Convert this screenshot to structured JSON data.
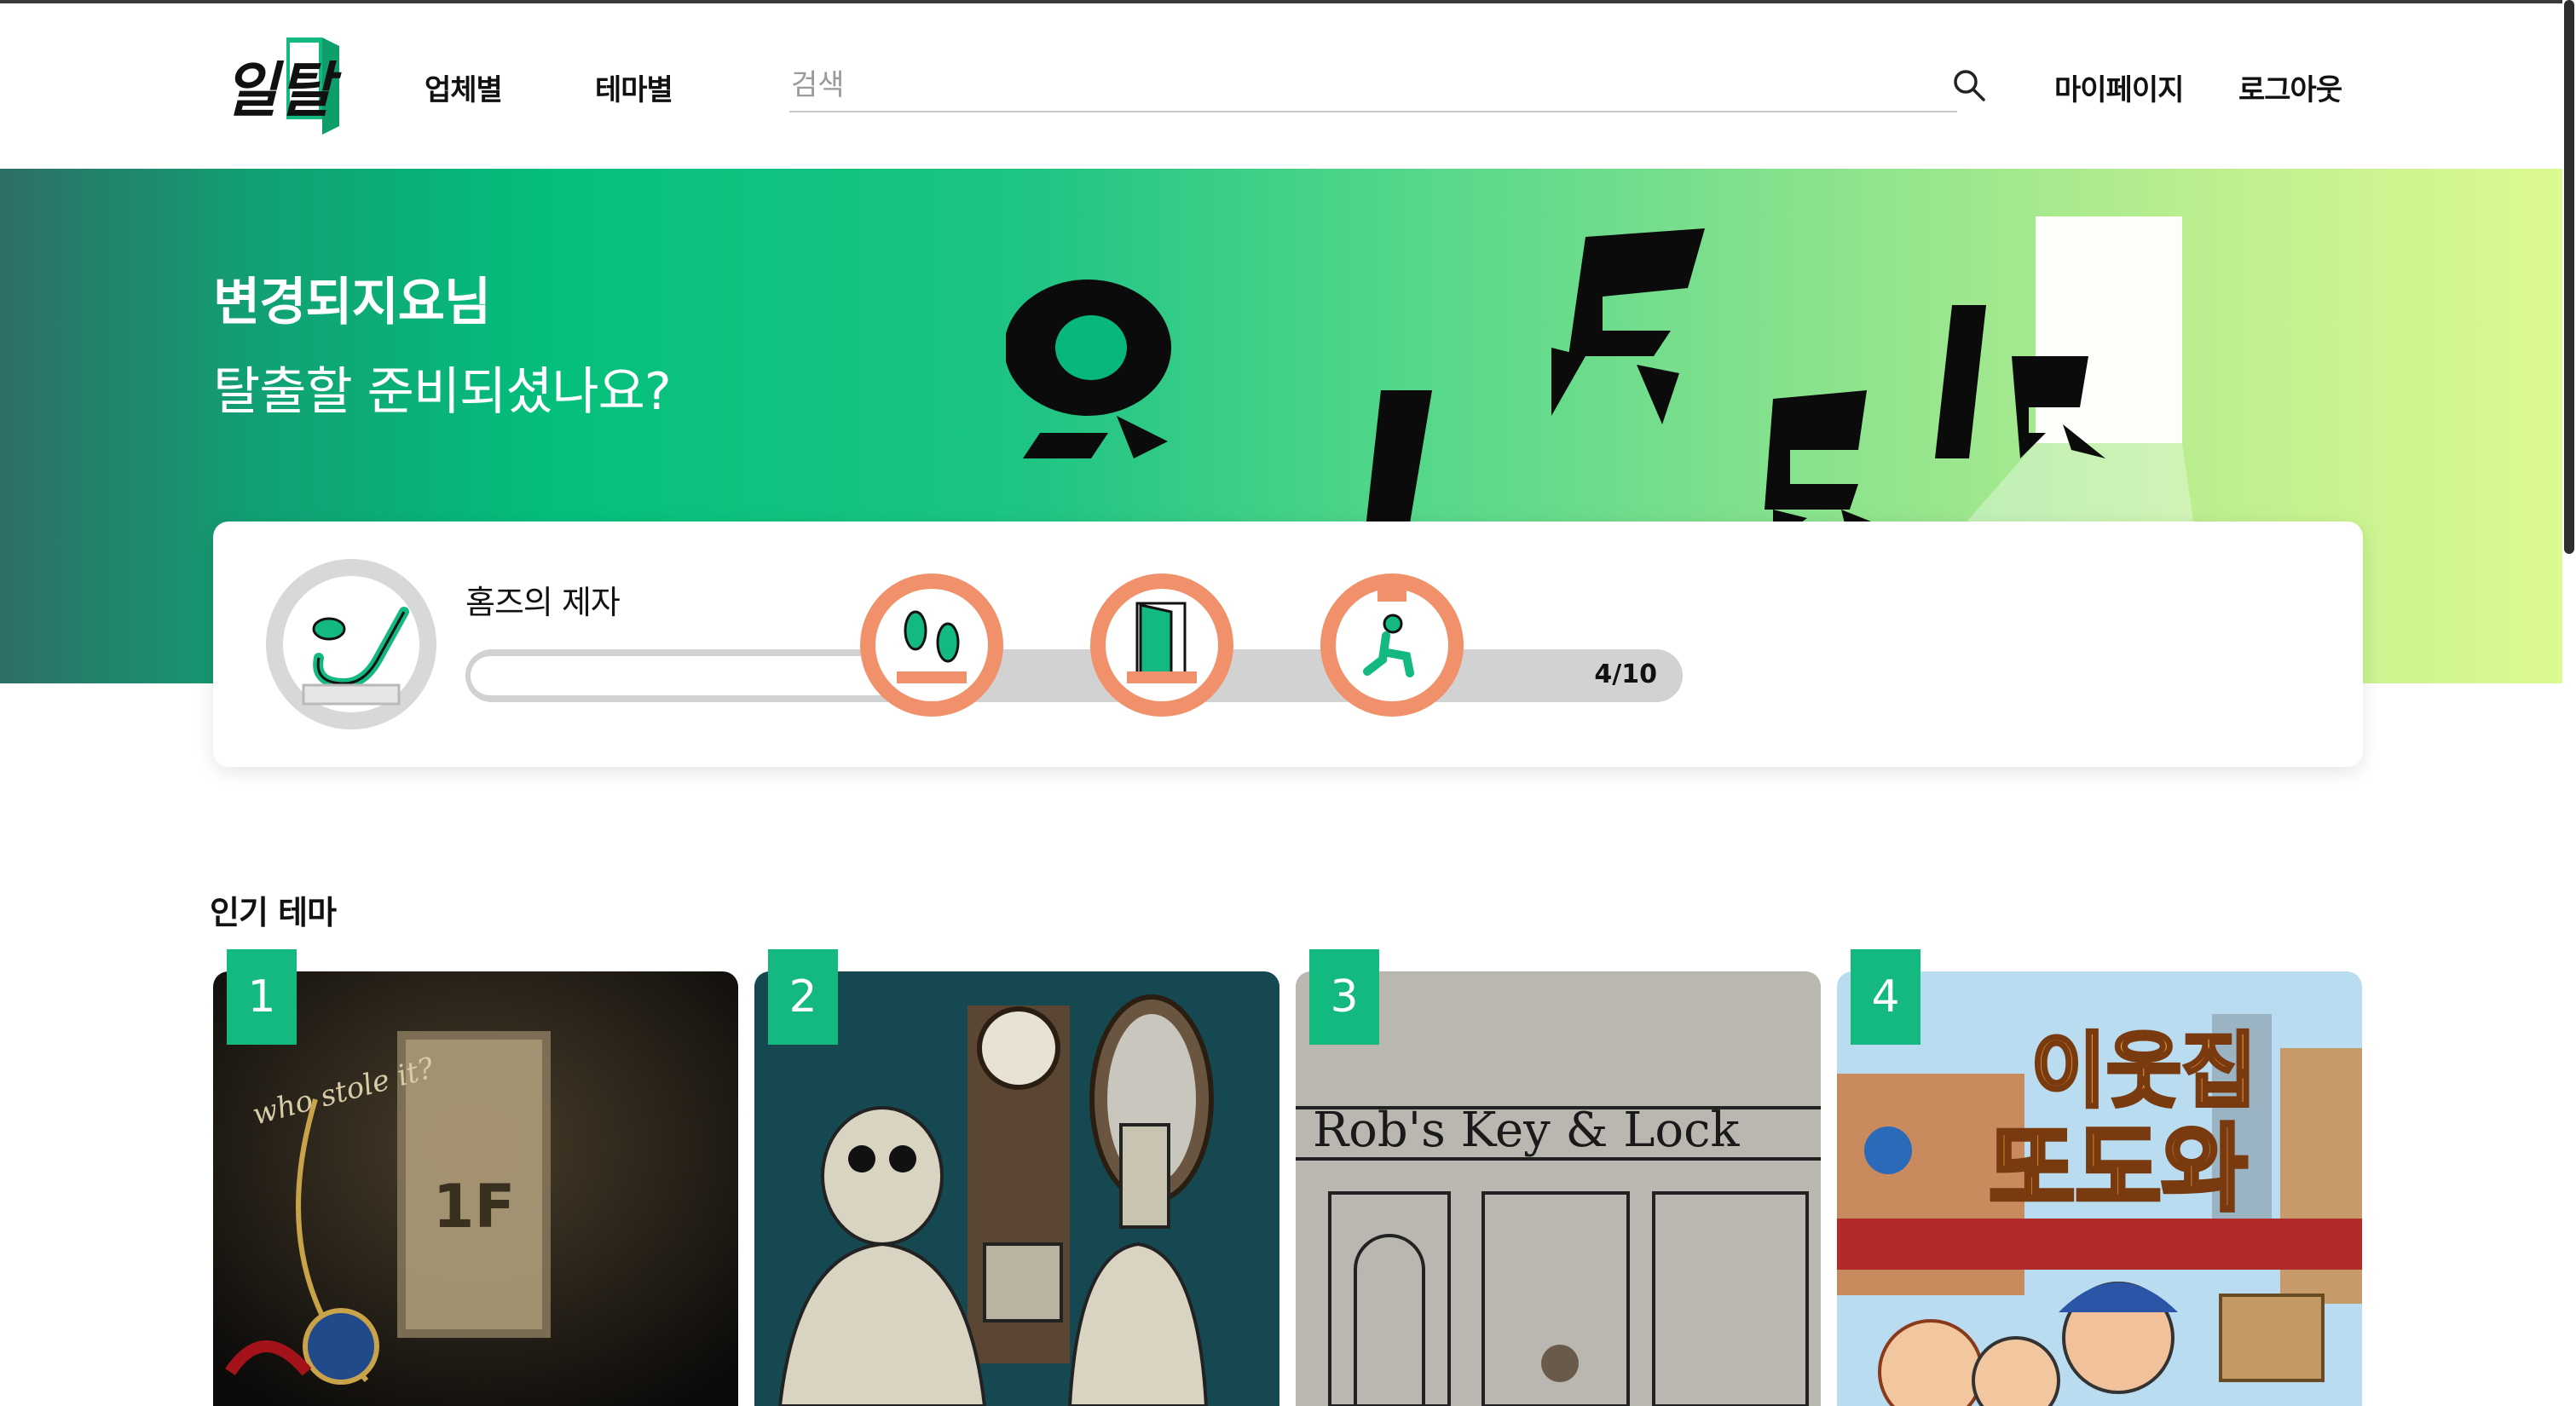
{
  "header": {
    "logo_text": "일탈",
    "nav": [
      {
        "label": "업체별"
      },
      {
        "label": "테마별"
      }
    ],
    "search": {
      "placeholder": "검색",
      "value": ""
    },
    "right_links": [
      {
        "label": "마이페이지"
      },
      {
        "label": "로그아웃"
      }
    ]
  },
  "hero": {
    "user_name": "변경되지요님",
    "subtitle": "탈출할 준비되셨나요?",
    "art_letters": "일탈"
  },
  "progress_card": {
    "theme_title": "홈즈의 제자",
    "progress_text": "4/10",
    "progress_fraction": 0.4,
    "badges": [
      {
        "icon": "footprints-icon"
      },
      {
        "icon": "exit-door-icon"
      },
      {
        "icon": "kneeling-person-icon"
      }
    ],
    "main_badge_icon": "pipe-icon"
  },
  "popular": {
    "title": "인기 테마",
    "themes": [
      {
        "rank": "1",
        "poster_text": "1F",
        "poster_script": "who stole it?"
      },
      {
        "rank": "2"
      },
      {
        "rank": "3",
        "sign_text": "Rob's Key & Lock"
      },
      {
        "rank": "4",
        "title_line1": "이웃집",
        "title_line2": "또도와"
      }
    ]
  },
  "colors": {
    "brand_green": "#13b97f",
    "badge_orange": "#f0916b",
    "hero_gradient_start": "#2e6e66",
    "hero_gradient_end": "#dcf992"
  }
}
